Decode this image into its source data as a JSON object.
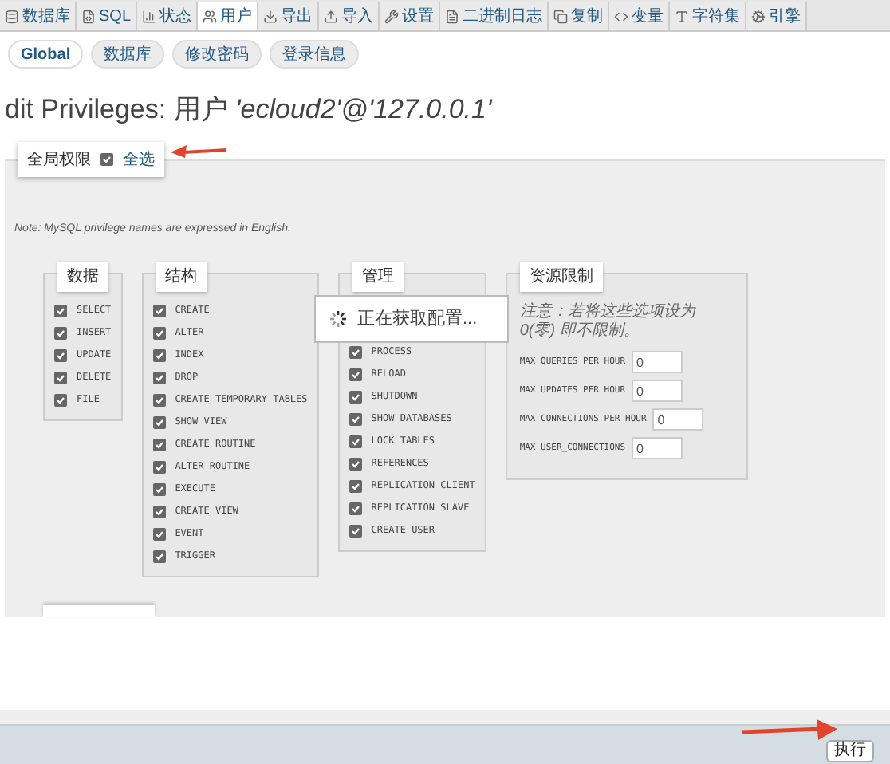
{
  "tabs": [
    {
      "label": "数据库",
      "selected": false
    },
    {
      "label": "SQL",
      "selected": false
    },
    {
      "label": "状态",
      "selected": false
    },
    {
      "label": "用户",
      "selected": true
    },
    {
      "label": "导出",
      "selected": false
    },
    {
      "label": "导入",
      "selected": false
    },
    {
      "label": "设置",
      "selected": false
    },
    {
      "label": "二进制日志",
      "selected": false
    },
    {
      "label": "复制",
      "selected": false
    },
    {
      "label": "变量",
      "selected": false
    },
    {
      "label": "字符集",
      "selected": false
    },
    {
      "label": "引擎",
      "selected": false
    }
  ],
  "subtabs": [
    {
      "label": "Global",
      "selected": true
    },
    {
      "label": "数据库",
      "selected": false
    },
    {
      "label": "修改密码",
      "selected": false
    },
    {
      "label": "登录信息",
      "selected": false
    }
  ],
  "heading": "dit Privileges: 用户 *'ecloud2'@'127.0.0.1'*",
  "global_privileges": {
    "legend": "全局权限",
    "select_all": {
      "label": "全选",
      "checked": true
    },
    "note": "Note: MySQL privilege names are expressed in English.",
    "groups": [
      {
        "legend": "数据",
        "items": [
          {
            "label": "SELECT",
            "checked": true
          },
          {
            "label": "INSERT",
            "checked": true
          },
          {
            "label": "UPDATE",
            "checked": true
          },
          {
            "label": "DELETE",
            "checked": true
          },
          {
            "label": "FILE",
            "checked": true
          }
        ]
      },
      {
        "legend": "结构",
        "items": [
          {
            "label": "CREATE",
            "checked": true
          },
          {
            "label": "ALTER",
            "checked": true
          },
          {
            "label": "INDEX",
            "checked": true
          },
          {
            "label": "DROP",
            "checked": true
          },
          {
            "label": "CREATE TEMPORARY TABLES",
            "checked": true
          },
          {
            "label": "SHOW VIEW",
            "checked": true
          },
          {
            "label": "CREATE ROUTINE",
            "checked": true
          },
          {
            "label": "ALTER ROUTINE",
            "checked": true
          },
          {
            "label": "EXECUTE",
            "checked": true
          },
          {
            "label": "CREATE VIEW",
            "checked": true
          },
          {
            "label": "EVENT",
            "checked": true
          },
          {
            "label": "TRIGGER",
            "checked": true
          }
        ]
      },
      {
        "legend": "管理",
        "items": [
          {
            "label": "PROCESS",
            "checked": true
          },
          {
            "label": "RELOAD",
            "checked": true
          },
          {
            "label": "SHUTDOWN",
            "checked": true
          },
          {
            "label": "SHOW DATABASES",
            "checked": true
          },
          {
            "label": "LOCK TABLES",
            "checked": true
          },
          {
            "label": "REFERENCES",
            "checked": true
          },
          {
            "label": "REPLICATION CLIENT",
            "checked": true
          },
          {
            "label": "REPLICATION SLAVE",
            "checked": true
          },
          {
            "label": "CREATE USER",
            "checked": true
          }
        ]
      }
    ],
    "resource_limits": {
      "legend": "资源限制",
      "note": "注意：若将这些选项设为 0(零) 即不限制。",
      "fields": [
        {
          "label": "MAX QUERIES PER HOUR",
          "value": "0"
        },
        {
          "label": "MAX UPDATES PER HOUR",
          "value": "0"
        },
        {
          "label": "MAX CONNECTIONS PER HOUR",
          "value": "0"
        },
        {
          "label": "MAX USER_CONNECTIONS",
          "value": "0"
        }
      ]
    }
  },
  "loading": {
    "message": "正在获取配置..."
  },
  "footer": {
    "button": "执行"
  }
}
